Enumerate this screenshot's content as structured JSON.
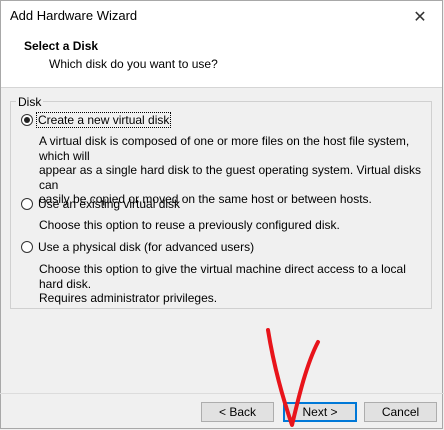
{
  "window": {
    "title": "Add Hardware Wizard"
  },
  "header": {
    "title": "Select a Disk",
    "subtitle": "Which disk do you want to use?"
  },
  "disk_group": {
    "legend": "Disk",
    "options": [
      {
        "label": "Create a new virtual disk",
        "checked": true,
        "description": [
          "A virtual disk is composed of one or more files on the host file system, which will",
          "appear as a single hard disk to the guest operating system. Virtual disks can",
          "easily be copied or moved on the same host or between hosts."
        ]
      },
      {
        "label": "Use an existing virtual disk",
        "checked": false,
        "description": [
          "Choose this option to reuse a previously configured disk."
        ]
      },
      {
        "label": "Use a physical disk (for advanced users)",
        "checked": false,
        "description": [
          "Choose this option to give the virtual machine direct access to a local hard disk.",
          "Requires administrator privileges."
        ]
      }
    ]
  },
  "buttons": {
    "back": "< Back",
    "next": "Next >",
    "cancel": "Cancel"
  },
  "icons": {
    "close": "close-icon"
  },
  "colors": {
    "annotation": "#e8141b",
    "focus_border": "#0078d7"
  }
}
